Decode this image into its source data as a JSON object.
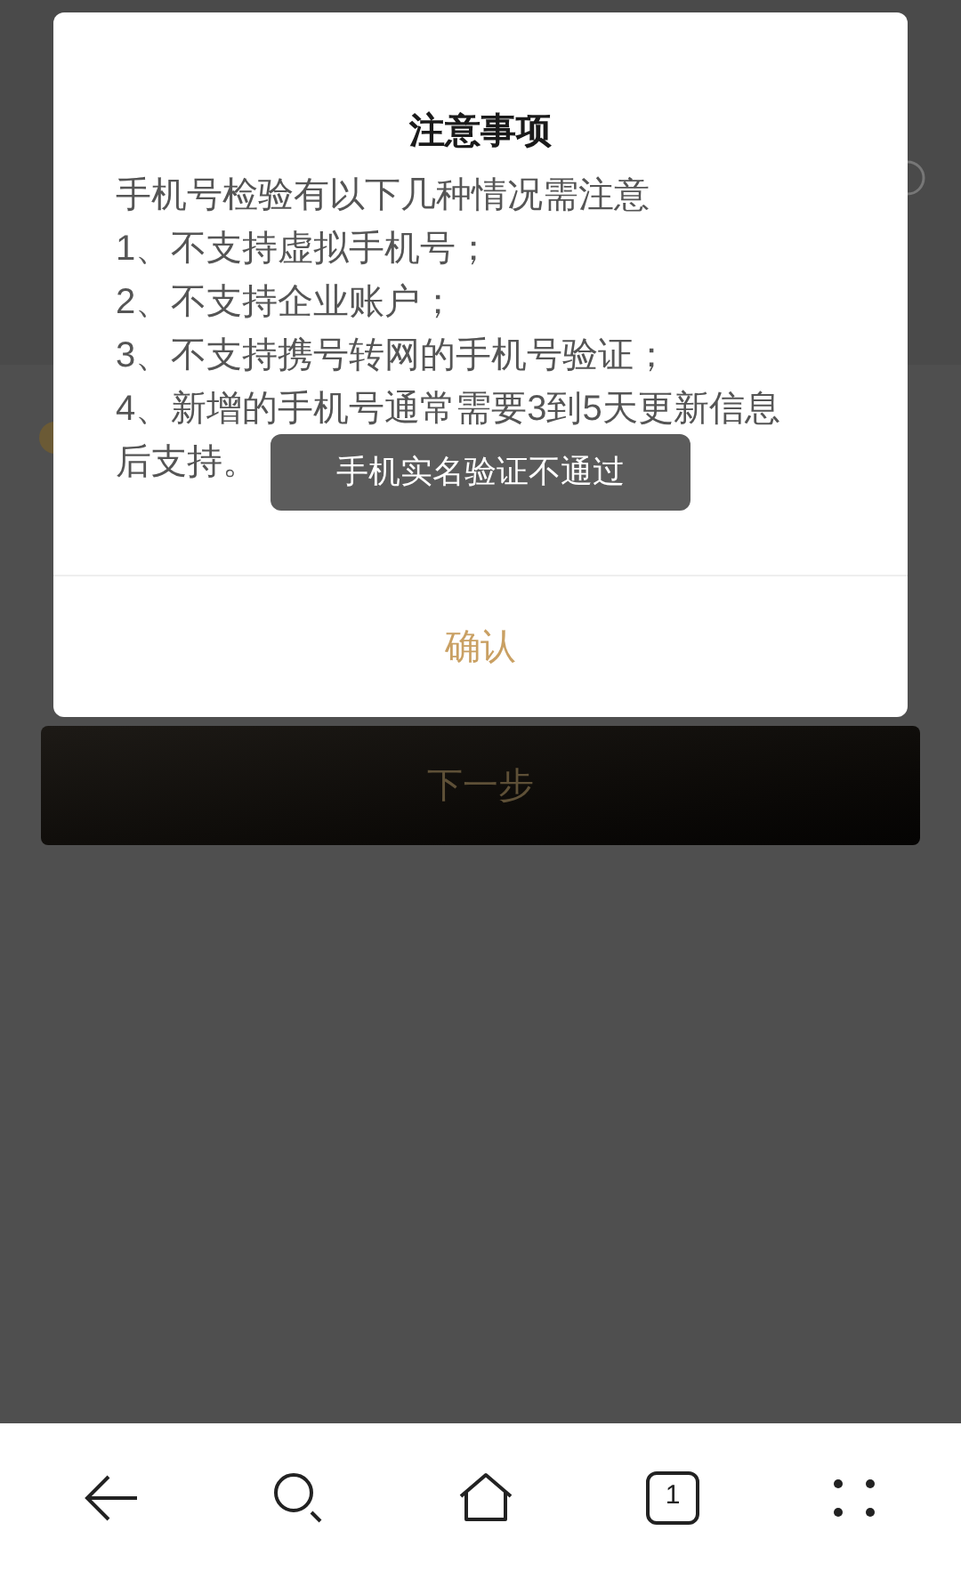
{
  "dialog": {
    "title": "注意事项",
    "intro": "手机号检验有以下几种情况需注意",
    "items": [
      "1、不支持虚拟手机号；",
      "2、不支持企业账户；",
      "3、不支持携号转网的手机号验证；",
      "4、新增的手机号通常需要3到5天更新信息",
      "后支持。"
    ],
    "confirm": "确认"
  },
  "toast": "手机实名验证不通过",
  "next_button": {
    "label": "下一步",
    "disabled": true
  },
  "bottom_nav": {
    "tab_count": "1"
  }
}
